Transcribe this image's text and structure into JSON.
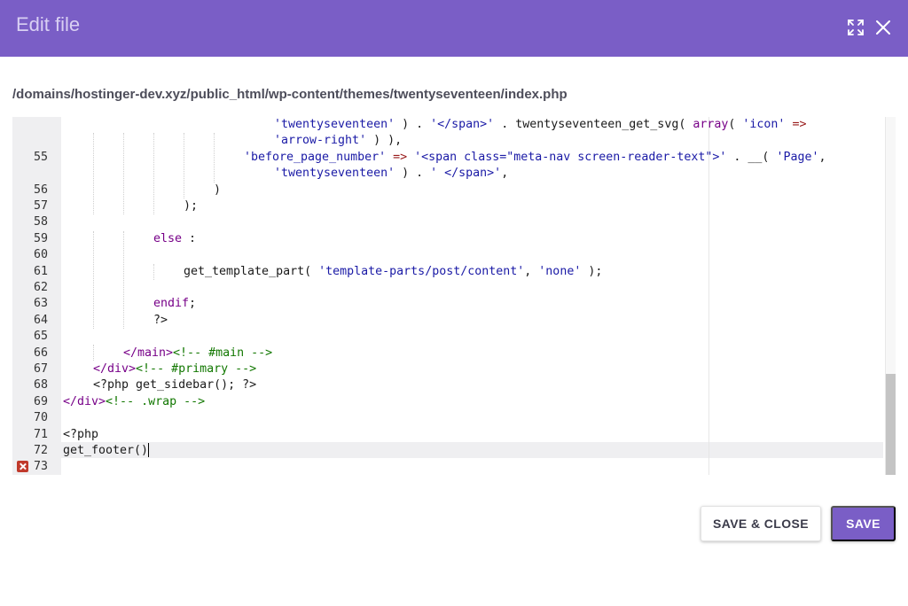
{
  "dialog": {
    "title": "Edit file",
    "file_path": "/domains/hostinger-dev.xyz/public_html/wp-content/themes/twentyseventeen/index.php"
  },
  "icons": {
    "expand": "expand-icon",
    "close": "close-icon",
    "error": "error-icon"
  },
  "colors": {
    "accent": "#7a5ec6",
    "error": "#c0392b"
  },
  "editor": {
    "line_numbers": [
      "",
      "",
      "55",
      "",
      "56",
      "57",
      "58",
      "59",
      "60",
      "61",
      "62",
      "63",
      "64",
      "65",
      "66",
      "67",
      "68",
      "69",
      "70",
      "71",
      "72",
      "73"
    ],
    "error_line": "73",
    "active_line": "72"
  },
  "code": {
    "l0_a": "'twentyseventeen'",
    "l0_b": " ) . ",
    "l0_c": "'</span>'",
    "l0_d": " . twentyseventeen_get_svg( ",
    "l0_e": "array",
    "l0_f": "( ",
    "l0_g": "'icon'",
    "l0_h": " =>",
    "l1_a": "'arrow-right'",
    "l1_b": " ) ),",
    "l2_a": "'before_page_number'",
    "l2_b": " => ",
    "l2_c": "'<span class=\"meta-nav screen-reader-text\">'",
    "l2_d": " . __( ",
    "l2_e": "'Page'",
    "l2_f": ",",
    "l3_a": "'twentyseventeen'",
    "l3_b": " ) . ",
    "l3_c": "' </span>'",
    "l3_d": ",",
    "l4": ")",
    "l5": ");",
    "l7": "else",
    "l7_b": " :",
    "l9_a": "get_template_part( ",
    "l9_b": "'template-parts/post/content'",
    "l9_c": ", ",
    "l9_d": "'none'",
    "l9_e": " );",
    "l11": "endif",
    "l11_b": ";",
    "l12": "?>",
    "l14_a": "</main>",
    "l14_b": "<!-- #main -->",
    "l15_a": "</div>",
    "l15_b": "<!-- #primary -->",
    "l16": "<?php get_sidebar(); ?>",
    "l17_a": "</div>",
    "l17_b": "<!-- .wrap -->",
    "l19": "<?php",
    "l20": "get_footer()"
  },
  "actions": {
    "save_close_label": "SAVE & CLOSE",
    "save_label": "SAVE"
  }
}
